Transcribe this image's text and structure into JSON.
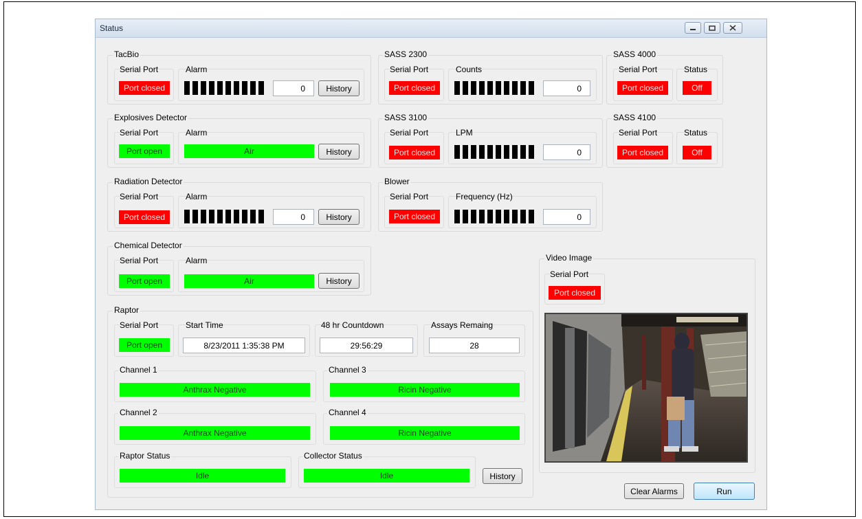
{
  "window": {
    "title": "Status"
  },
  "labels": {
    "serial_port": "Serial Port",
    "alarm": "Alarm",
    "status": "Status",
    "history": "History"
  },
  "tacbio": {
    "title": "TacBio",
    "port": "Port closed",
    "value": "0"
  },
  "explosives": {
    "title": "Explosives Detector",
    "port": "Port open",
    "alarm": "Air"
  },
  "radiation": {
    "title": "Radiation Detector",
    "port": "Port closed",
    "value": "0"
  },
  "chemical": {
    "title": "Chemical Detector",
    "port": "Port open",
    "alarm": "Air"
  },
  "sass2300": {
    "title": "SASS 2300",
    "metric_label": "Counts",
    "port": "Port closed",
    "value": "0"
  },
  "sass3100": {
    "title": "SASS 3100",
    "metric_label": "LPM",
    "port": "Port closed",
    "value": "0"
  },
  "blower": {
    "title": "Blower",
    "metric_label": "Frequency (Hz)",
    "port": "Port closed",
    "value": "0"
  },
  "sass4000": {
    "title": "SASS 4000",
    "port": "Port closed",
    "status": "Off"
  },
  "sass4100": {
    "title": "SASS 4100",
    "port": "Port closed",
    "status": "Off"
  },
  "raptor": {
    "title": "Raptor",
    "port": "Port open",
    "start_time_label": "Start Time",
    "start_time": "8/23/2011 1:35:38 PM",
    "countdown_label": "48 hr Countdown",
    "countdown": "29:56:29",
    "assays_label": "Assays Remaing",
    "assays": "28",
    "channels": [
      {
        "label": "Channel 1",
        "value": "Anthrax Negative"
      },
      {
        "label": "Channel 2",
        "value": "Anthrax Negative"
      },
      {
        "label": "Channel 3",
        "value": "Ricin Negative"
      },
      {
        "label": "Channel 4",
        "value": "Ricin Negative"
      }
    ],
    "raptor_status_label": "Raptor Status",
    "raptor_status": "Idle",
    "collector_status_label": "Collector Status",
    "collector_status": "Idle"
  },
  "video": {
    "title": "Video Image",
    "port": "Port closed"
  },
  "buttons": {
    "clear_alarms": "Clear Alarms",
    "run": "Run"
  },
  "colors": {
    "alarm_red": "#ff0000",
    "ok_green": "#00ff00",
    "window_bg": "#efefef"
  }
}
